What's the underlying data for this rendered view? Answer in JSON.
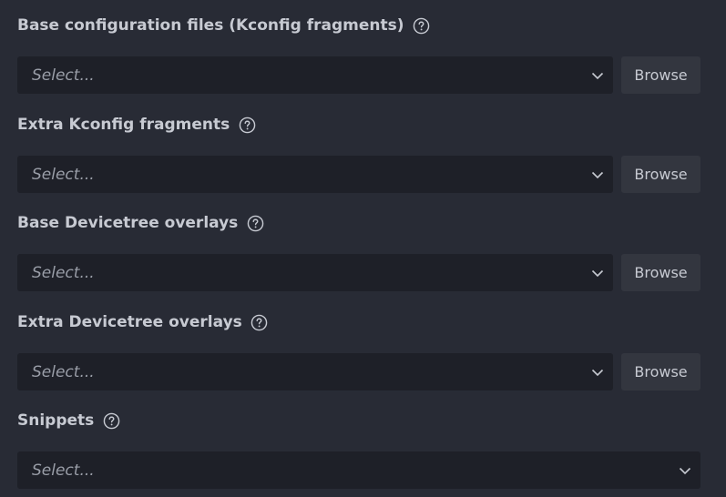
{
  "fields": [
    {
      "label": "Base configuration files (Kconfig fragments)",
      "value": "Select...",
      "browse_label": "Browse"
    },
    {
      "label": "Extra Kconfig fragments",
      "value": "Select...",
      "browse_label": "Browse"
    },
    {
      "label": "Base Devicetree overlays",
      "value": "Select...",
      "browse_label": "Browse"
    },
    {
      "label": "Extra Devicetree overlays",
      "value": "Select...",
      "browse_label": "Browse"
    },
    {
      "label": "Snippets",
      "value": "Select..."
    }
  ],
  "icons": {
    "help": "question-circle-icon",
    "dropdown": "chevron-down-icon"
  },
  "colors": {
    "background": "#282b35",
    "select_background": "#1e2028",
    "button_background": "#33363f",
    "text": "#c7cad2",
    "placeholder": "#9a9ea8"
  }
}
